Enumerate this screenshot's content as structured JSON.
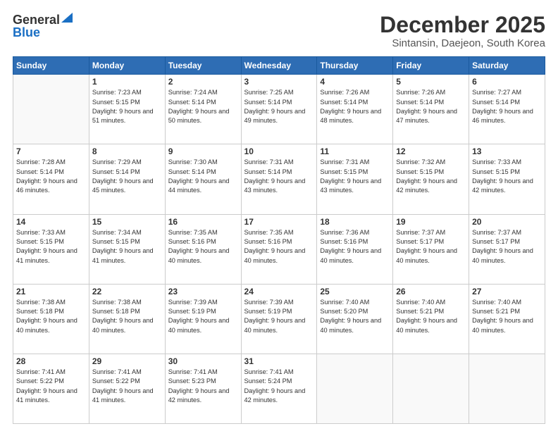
{
  "header": {
    "logo_general": "General",
    "logo_blue": "Blue",
    "title": "December 2025",
    "subtitle": "Sintansin, Daejeon, South Korea"
  },
  "calendar": {
    "days_of_week": [
      "Sunday",
      "Monday",
      "Tuesday",
      "Wednesday",
      "Thursday",
      "Friday",
      "Saturday"
    ],
    "weeks": [
      [
        {
          "day": "",
          "empty": true
        },
        {
          "day": "1",
          "sunrise": "7:23 AM",
          "sunset": "5:15 PM",
          "daylight": "9 hours and 51 minutes."
        },
        {
          "day": "2",
          "sunrise": "7:24 AM",
          "sunset": "5:14 PM",
          "daylight": "9 hours and 50 minutes."
        },
        {
          "day": "3",
          "sunrise": "7:25 AM",
          "sunset": "5:14 PM",
          "daylight": "9 hours and 49 minutes."
        },
        {
          "day": "4",
          "sunrise": "7:26 AM",
          "sunset": "5:14 PM",
          "daylight": "9 hours and 48 minutes."
        },
        {
          "day": "5",
          "sunrise": "7:26 AM",
          "sunset": "5:14 PM",
          "daylight": "9 hours and 47 minutes."
        },
        {
          "day": "6",
          "sunrise": "7:27 AM",
          "sunset": "5:14 PM",
          "daylight": "9 hours and 46 minutes."
        }
      ],
      [
        {
          "day": "7",
          "sunrise": "7:28 AM",
          "sunset": "5:14 PM",
          "daylight": "9 hours and 46 minutes."
        },
        {
          "day": "8",
          "sunrise": "7:29 AM",
          "sunset": "5:14 PM",
          "daylight": "9 hours and 45 minutes."
        },
        {
          "day": "9",
          "sunrise": "7:30 AM",
          "sunset": "5:14 PM",
          "daylight": "9 hours and 44 minutes."
        },
        {
          "day": "10",
          "sunrise": "7:31 AM",
          "sunset": "5:14 PM",
          "daylight": "9 hours and 43 minutes."
        },
        {
          "day": "11",
          "sunrise": "7:31 AM",
          "sunset": "5:15 PM",
          "daylight": "9 hours and 43 minutes."
        },
        {
          "day": "12",
          "sunrise": "7:32 AM",
          "sunset": "5:15 PM",
          "daylight": "9 hours and 42 minutes."
        },
        {
          "day": "13",
          "sunrise": "7:33 AM",
          "sunset": "5:15 PM",
          "daylight": "9 hours and 42 minutes."
        }
      ],
      [
        {
          "day": "14",
          "sunrise": "7:33 AM",
          "sunset": "5:15 PM",
          "daylight": "9 hours and 41 minutes."
        },
        {
          "day": "15",
          "sunrise": "7:34 AM",
          "sunset": "5:15 PM",
          "daylight": "9 hours and 41 minutes."
        },
        {
          "day": "16",
          "sunrise": "7:35 AM",
          "sunset": "5:16 PM",
          "daylight": "9 hours and 40 minutes."
        },
        {
          "day": "17",
          "sunrise": "7:35 AM",
          "sunset": "5:16 PM",
          "daylight": "9 hours and 40 minutes."
        },
        {
          "day": "18",
          "sunrise": "7:36 AM",
          "sunset": "5:16 PM",
          "daylight": "9 hours and 40 minutes."
        },
        {
          "day": "19",
          "sunrise": "7:37 AM",
          "sunset": "5:17 PM",
          "daylight": "9 hours and 40 minutes."
        },
        {
          "day": "20",
          "sunrise": "7:37 AM",
          "sunset": "5:17 PM",
          "daylight": "9 hours and 40 minutes."
        }
      ],
      [
        {
          "day": "21",
          "sunrise": "7:38 AM",
          "sunset": "5:18 PM",
          "daylight": "9 hours and 40 minutes."
        },
        {
          "day": "22",
          "sunrise": "7:38 AM",
          "sunset": "5:18 PM",
          "daylight": "9 hours and 40 minutes."
        },
        {
          "day": "23",
          "sunrise": "7:39 AM",
          "sunset": "5:19 PM",
          "daylight": "9 hours and 40 minutes."
        },
        {
          "day": "24",
          "sunrise": "7:39 AM",
          "sunset": "5:19 PM",
          "daylight": "9 hours and 40 minutes."
        },
        {
          "day": "25",
          "sunrise": "7:40 AM",
          "sunset": "5:20 PM",
          "daylight": "9 hours and 40 minutes."
        },
        {
          "day": "26",
          "sunrise": "7:40 AM",
          "sunset": "5:21 PM",
          "daylight": "9 hours and 40 minutes."
        },
        {
          "day": "27",
          "sunrise": "7:40 AM",
          "sunset": "5:21 PM",
          "daylight": "9 hours and 40 minutes."
        }
      ],
      [
        {
          "day": "28",
          "sunrise": "7:41 AM",
          "sunset": "5:22 PM",
          "daylight": "9 hours and 41 minutes."
        },
        {
          "day": "29",
          "sunrise": "7:41 AM",
          "sunset": "5:22 PM",
          "daylight": "9 hours and 41 minutes."
        },
        {
          "day": "30",
          "sunrise": "7:41 AM",
          "sunset": "5:23 PM",
          "daylight": "9 hours and 42 minutes."
        },
        {
          "day": "31",
          "sunrise": "7:41 AM",
          "sunset": "5:24 PM",
          "daylight": "9 hours and 42 minutes."
        },
        {
          "day": "",
          "empty": true
        },
        {
          "day": "",
          "empty": true
        },
        {
          "day": "",
          "empty": true
        }
      ]
    ],
    "labels": {
      "sunrise": "Sunrise:",
      "sunset": "Sunset:",
      "daylight": "Daylight:"
    }
  }
}
